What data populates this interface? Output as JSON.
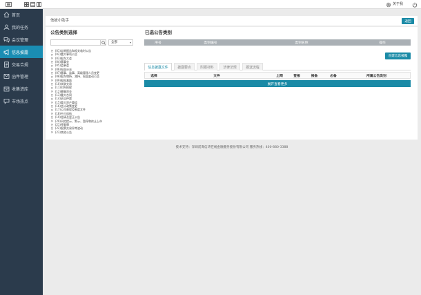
{
  "topbar": {
    "icons": [
      "menu-icon",
      "layout-grid-icon",
      "layout-list-icon",
      "layout-columns-icon",
      "gear-icon",
      "power-icon"
    ],
    "about_label": "关于我"
  },
  "sidebar": {
    "items": [
      {
        "label": "首页",
        "icon": "home-icon",
        "active": false
      },
      {
        "label": "我的任务",
        "icon": "user-task-icon",
        "active": false
      },
      {
        "label": "会议管理",
        "icon": "meeting-icon",
        "active": false
      },
      {
        "label": "信息披露",
        "icon": "megaphone-icon",
        "active": true
      },
      {
        "label": "交易合规",
        "icon": "document-icon",
        "active": false
      },
      {
        "label": "函件管理",
        "icon": "letter-icon",
        "active": false
      },
      {
        "label": "收集进库",
        "icon": "archive-icon",
        "active": false
      },
      {
        "label": "市场热点",
        "icon": "chat-icon",
        "active": false
      }
    ]
  },
  "breadcrumb": {
    "title": "信披小助手",
    "back_label": "返回"
  },
  "category_panel": {
    "heading": "公告类别选择",
    "search_value": "",
    "filter_selected": "全部",
    "tree": [
      "(01)定期报告和相关临时公告",
      "(02)重大事项公告",
      "(03)股东大会",
      "(04)董事会",
      "(05)监事会",
      "(06)权益分派",
      "(07)董事、监事、高级管理人员变更",
      "(08)股东增持、减持、权益变动公告",
      "(09)股权激励",
      "(10)关联交易",
      "(11)对外担保",
      "(12)募集资金",
      "(13)重大合同",
      "(14)诉讼仲裁",
      "(15)重大资产重组",
      "(16)会计政策变更",
      "(17)公司章程及制度文件",
      "(18)中介机构",
      "(19)澄清及更正公告",
      "(20)风险提示、警示、暂停和终止上市",
      "(21)停复牌",
      "(22)股票交易异常波动",
      "(23)其他公告"
    ]
  },
  "selected_panel": {
    "heading": "已选公告类别",
    "columns": [
      "序号",
      "类别编号",
      "类别名称",
      "操作"
    ],
    "create_label": "创建信息披露",
    "tabs": [
      {
        "label": "信息披露文件",
        "active": true
      },
      {
        "label": "披露要点",
        "active": false
      },
      {
        "label": "附报材料",
        "active": false
      },
      {
        "label": "法律法规",
        "active": false
      },
      {
        "label": "报送流程",
        "active": false
      }
    ],
    "file_columns": [
      "选择",
      "文件",
      "上网",
      "登报",
      "报备",
      "必备",
      "所属公告类别"
    ],
    "expand_label": "展开查看更多"
  },
  "footer": {
    "text": "技术支持：深圳前海信湾在线金融服务股份有限公司  服务热线：400-880-3388"
  },
  "colors": {
    "accent": "#1a8aa6",
    "sidebar": "#2b3b4c",
    "sidebar_active": "#1a8db3",
    "header_bar": "#aab0b5",
    "background": "#ebebeb"
  }
}
